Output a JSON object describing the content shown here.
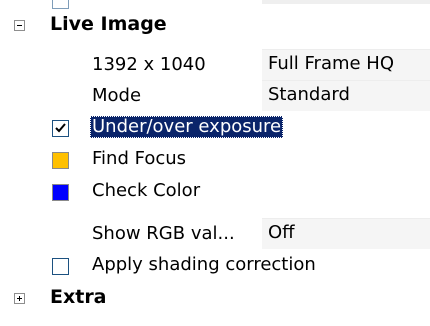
{
  "live_image": {
    "label": "Live Image",
    "properties": {
      "resolution": {
        "name": "1392 x 1040",
        "value": "Full Frame HQ"
      },
      "mode": {
        "name": "Mode",
        "value": "Standard"
      },
      "under_over_exposure": {
        "label": "Under/over exposure",
        "checked": true
      },
      "find_focus": {
        "label": "Find Focus",
        "color": "#ffc000"
      },
      "check_color": {
        "label": "Check Color",
        "color": "#0000ff"
      },
      "show_rgb": {
        "name": "Show RGB val...",
        "value": "Off"
      },
      "apply_shading": {
        "label": "Apply shading correction",
        "checked": false
      }
    }
  },
  "extra": {
    "label": "Extra"
  },
  "colors": {
    "selection": "#0a246a",
    "value_background": "#f5f5f5"
  }
}
